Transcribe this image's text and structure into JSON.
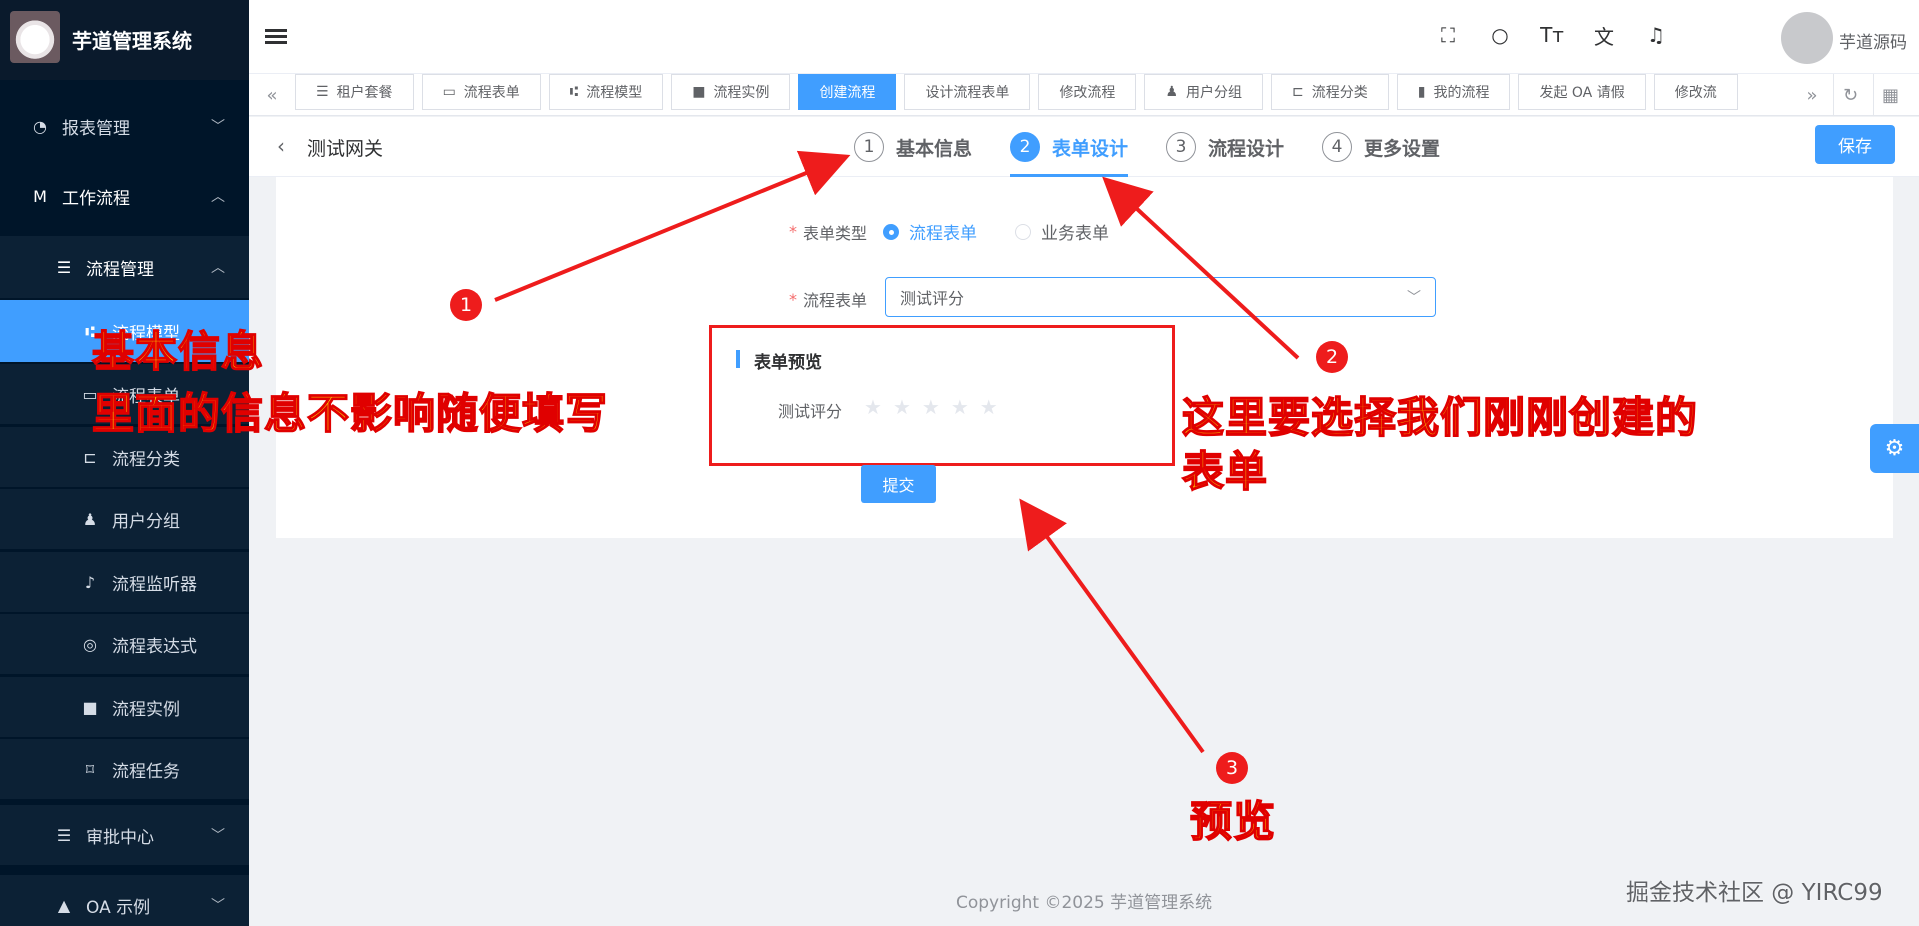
{
  "app": {
    "title": "芋道管理系统",
    "username": "芋道源码"
  },
  "sidebar": {
    "items": [
      {
        "label": "报表管理",
        "icon": "pie-chart-icon",
        "arrow": "﹀"
      },
      {
        "label": "工作流程",
        "icon": "workflow-logo-icon",
        "arrow": "︿"
      },
      {
        "label": "流程管理",
        "icon": "list-icon",
        "arrow": "︿"
      },
      {
        "label": "流程模型",
        "icon": "model-icon"
      },
      {
        "label": "流程表单",
        "icon": "form-icon"
      },
      {
        "label": "流程分类",
        "icon": "category-icon"
      },
      {
        "label": "用户分组",
        "icon": "user-group-icon"
      },
      {
        "label": "流程监听器",
        "icon": "listener-icon"
      },
      {
        "label": "流程表达式",
        "icon": "expression-icon"
      },
      {
        "label": "流程实例",
        "icon": "instance-icon"
      },
      {
        "label": "流程任务",
        "icon": "bookmark-icon"
      },
      {
        "label": "审批中心",
        "icon": "approval-icon",
        "arrow": "﹀"
      },
      {
        "label": "OA 示例",
        "icon": "oa-icon",
        "arrow": "﹀"
      }
    ]
  },
  "tags": [
    {
      "label": "租户套餐",
      "icon": "☰"
    },
    {
      "label": "流程表单",
      "icon": "▭"
    },
    {
      "label": "流程模型",
      "icon": "⑆"
    },
    {
      "label": "流程实例",
      "icon": "■"
    },
    {
      "label": "创建流程",
      "icon": ""
    },
    {
      "label": "设计流程表单",
      "icon": ""
    },
    {
      "label": "修改流程",
      "icon": ""
    },
    {
      "label": "用户分组",
      "icon": "♟"
    },
    {
      "label": "流程分类",
      "icon": "⊏"
    },
    {
      "label": "我的流程",
      "icon": "▮"
    },
    {
      "label": "发起 OA 请假",
      "icon": ""
    },
    {
      "label": "修改流",
      "icon": ""
    }
  ],
  "page": {
    "back_title": "测试网关",
    "save_label": "保存",
    "steps": [
      {
        "num": "1",
        "label": "基本信息"
      },
      {
        "num": "2",
        "label": "表单设计"
      },
      {
        "num": "3",
        "label": "流程设计"
      },
      {
        "num": "4",
        "label": "更多设置"
      }
    ],
    "active_step": 2
  },
  "form": {
    "type_label": "表单类型",
    "type_options": [
      "流程表单",
      "业务表单"
    ],
    "type_selected": "流程表单",
    "form_label": "流程表单",
    "form_value": "测试评分",
    "preview_title": "表单预览",
    "preview_field": "测试评分",
    "preview_rating": 0,
    "submit_label": "提交"
  },
  "footer": {
    "copyright": "Copyright ©2025 芋道管理系统",
    "watermark": "掘金技术社区 @ YIRC99"
  },
  "annotations": [
    {
      "badge": "1",
      "text_lines": [
        "基本信息",
        "里面的信息不影响随便填写"
      ]
    },
    {
      "badge": "2",
      "text_lines": [
        "这里要选择我们刚刚创建的",
        "表单"
      ]
    },
    {
      "badge": "3",
      "text_lines": [
        "预览"
      ]
    }
  ],
  "colors": {
    "primary": "#409eff",
    "sidebar_bg": "#001529",
    "annotation": "#ee1c1c",
    "annotation_text": "#ffd400"
  }
}
